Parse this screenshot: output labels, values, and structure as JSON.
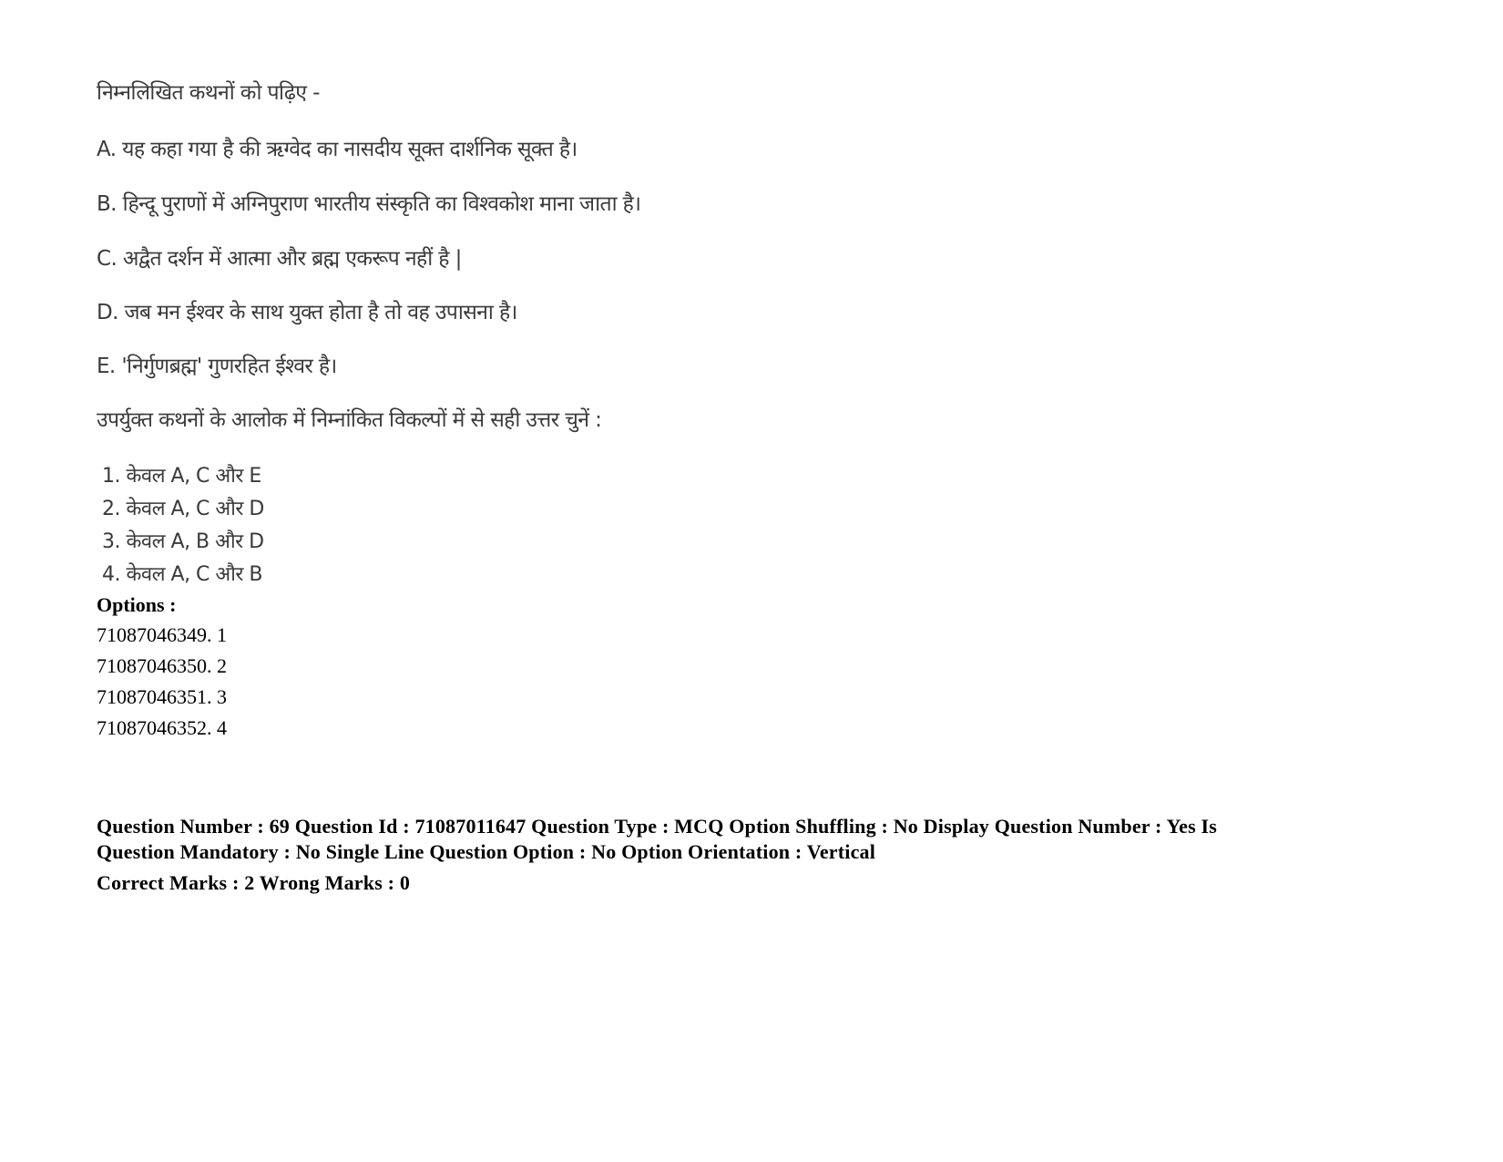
{
  "question": {
    "instruction": "निम्नलिखित कथनों को पढ़िए  -",
    "statements": [
      "A. यह कहा गया है की ऋग्वेद का नासदीय सूक्त दार्शनिक सूक्त है।",
      "B. हिन्दू पुराणों में अग्निपुराण भारतीय संस्कृति का विश्वकोश माना जाता है।",
      "C. अद्वैत दर्शन में आत्मा और ब्रह्म एकरूप नहीं है |",
      "D. जब मन ईश्वर के साथ युक्त होता है तो वह उपासना है।",
      "E. 'निर्गुणब्रह्म' गुणरहित ईश्वर है।"
    ],
    "prompt": "उपर्युक्त कथनों के आलोक में निम्नांकित विकल्पों में से  सही उत्तर चुनें :",
    "choices": [
      "1. केवल A, C और  E",
      "2. केवल A, C और D",
      "3. केवल A, B और  D",
      "4. केवल A, C और  B"
    ]
  },
  "options": {
    "heading": "Options :",
    "items": [
      "71087046349. 1",
      "71087046350. 2",
      "71087046351. 3",
      "71087046352. 4"
    ]
  },
  "meta": {
    "line1": "Question Number : 69 Question Id : 71087011647 Question Type : MCQ Option Shuffling : No Display Question Number : Yes Is",
    "line2": "Question Mandatory : No Single Line Question Option : No Option Orientation : Vertical",
    "marks": "Correct Marks : 2 Wrong Marks : 0"
  }
}
